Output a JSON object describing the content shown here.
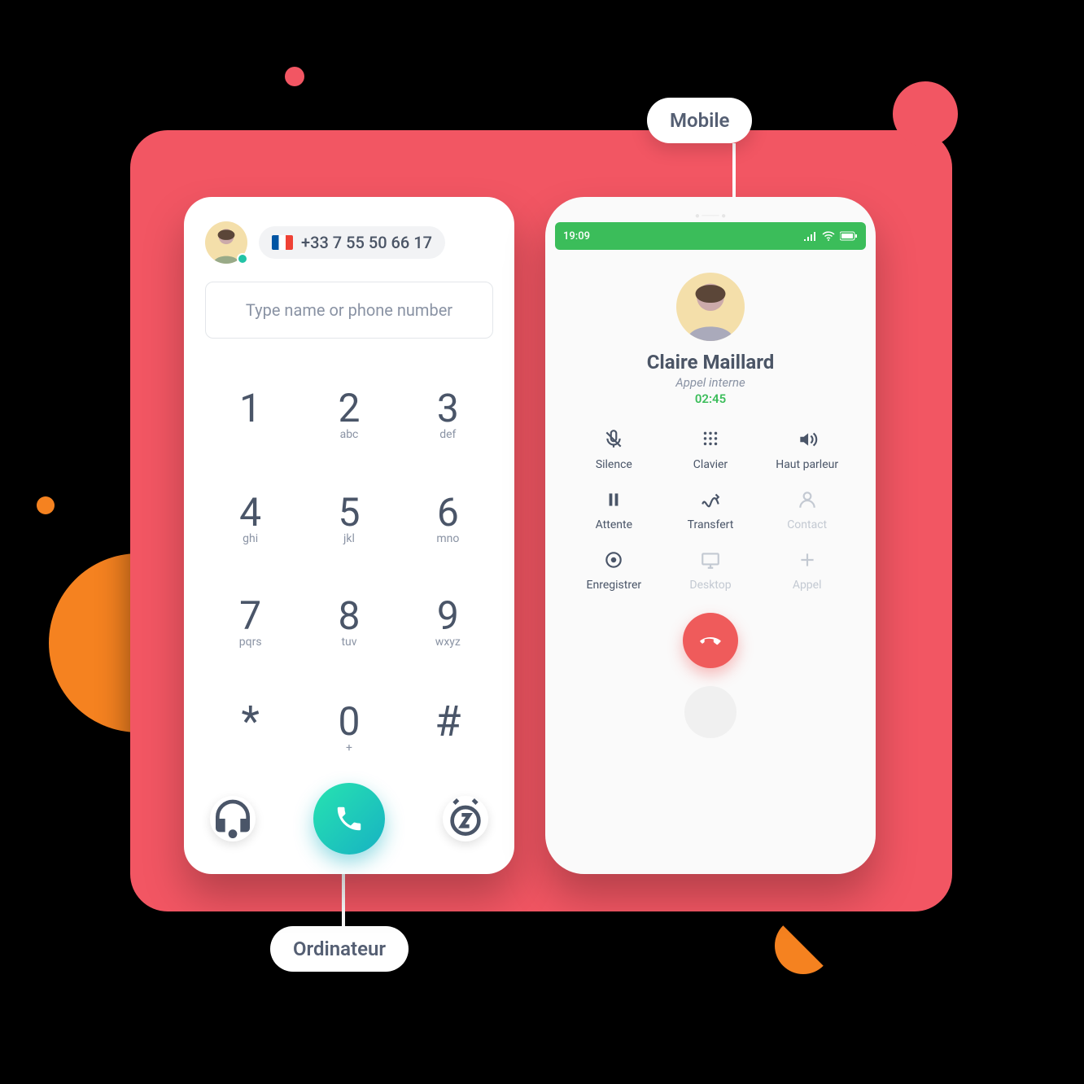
{
  "labels": {
    "mobile": "Mobile",
    "desktop": "Ordinateur"
  },
  "dialer": {
    "phone_number": "+33 7 55 50 66 17",
    "search_placeholder": "Type name or phone number",
    "keys": [
      {
        "d": "1",
        "l": ""
      },
      {
        "d": "2",
        "l": "abc"
      },
      {
        "d": "3",
        "l": "def"
      },
      {
        "d": "4",
        "l": "ghi"
      },
      {
        "d": "5",
        "l": "jkl"
      },
      {
        "d": "6",
        "l": "mno"
      },
      {
        "d": "7",
        "l": "pqrs"
      },
      {
        "d": "8",
        "l": "tuv"
      },
      {
        "d": "9",
        "l": "wxyz"
      },
      {
        "d": "*",
        "l": ""
      },
      {
        "d": "0",
        "l": "+"
      },
      {
        "d": "#",
        "l": ""
      }
    ]
  },
  "mobile": {
    "time": "19:09",
    "caller_name": "Claire Maillard",
    "call_type": "Appel interne",
    "duration": "02:45",
    "actions": [
      {
        "id": "mute",
        "label": "Silence",
        "enabled": true
      },
      {
        "id": "keypad",
        "label": "Clavier",
        "enabled": true
      },
      {
        "id": "speaker",
        "label": "Haut parleur",
        "enabled": true
      },
      {
        "id": "hold",
        "label": "Attente",
        "enabled": true
      },
      {
        "id": "transfer",
        "label": "Transfert",
        "enabled": true
      },
      {
        "id": "contact",
        "label": "Contact",
        "enabled": false
      },
      {
        "id": "record",
        "label": "Enregistrer",
        "enabled": true
      },
      {
        "id": "desktop",
        "label": "Desktop",
        "enabled": false
      },
      {
        "id": "addcall",
        "label": "Appel",
        "enabled": false
      }
    ]
  }
}
